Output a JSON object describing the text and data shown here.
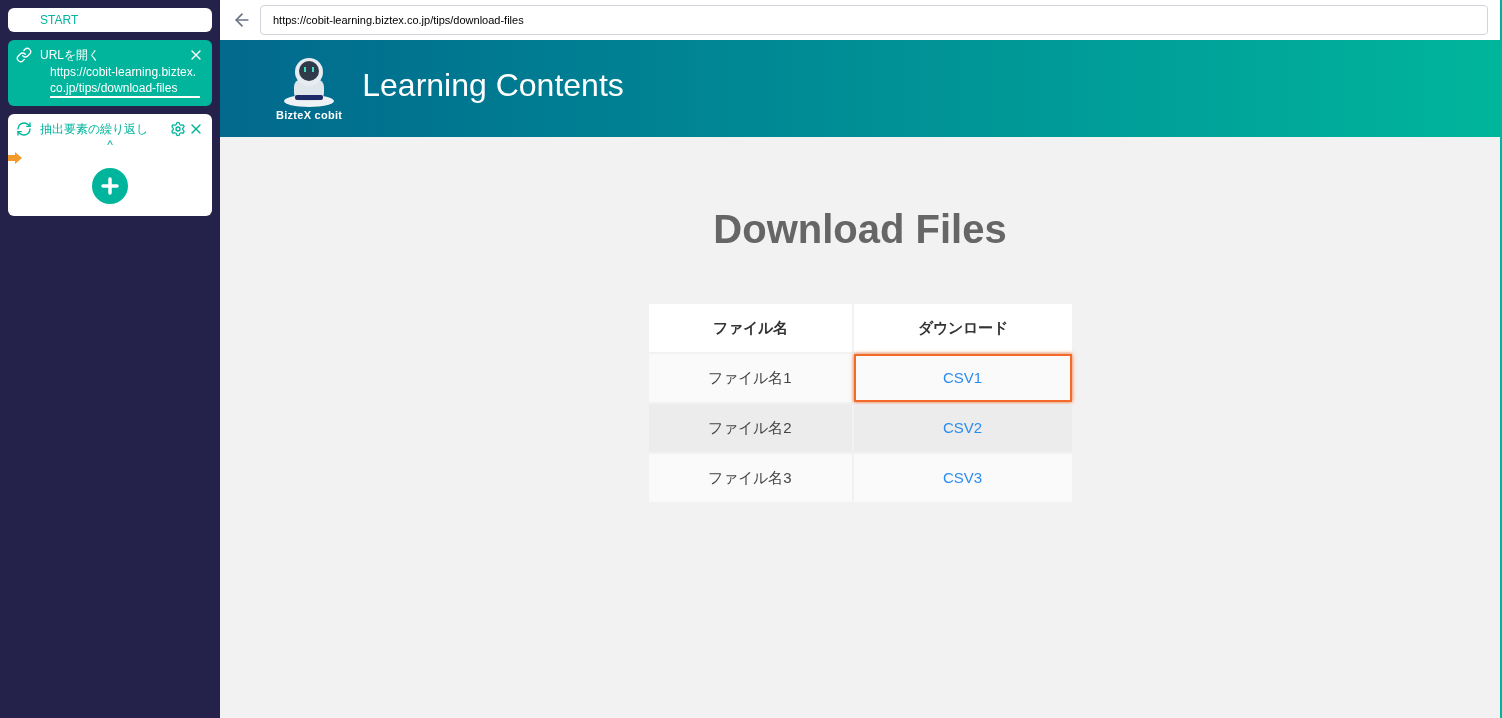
{
  "sidebar": {
    "start": {
      "label": "START"
    },
    "steps": [
      {
        "kind": "open_url",
        "title": "URLを開く",
        "value": "https://cobit-learning.biztex.co.jp/tips/download-files"
      },
      {
        "kind": "loop",
        "title": "抽出要素の繰り返し",
        "collapse": "^"
      }
    ]
  },
  "browser": {
    "url": "https://cobit-learning.biztex.co.jp/tips/download-files"
  },
  "page": {
    "logo_text": "BizteX cobit",
    "header_title": "Learning Contents",
    "heading": "Download Files",
    "table": {
      "columns": [
        "ファイル名",
        "ダウンロード"
      ],
      "rows": [
        {
          "name": "ファイル名1",
          "link": "CSV1",
          "highlighted": true
        },
        {
          "name": "ファイル名2",
          "link": "CSV2",
          "highlighted": false
        },
        {
          "name": "ファイル名3",
          "link": "CSV3",
          "highlighted": false
        }
      ]
    }
  }
}
